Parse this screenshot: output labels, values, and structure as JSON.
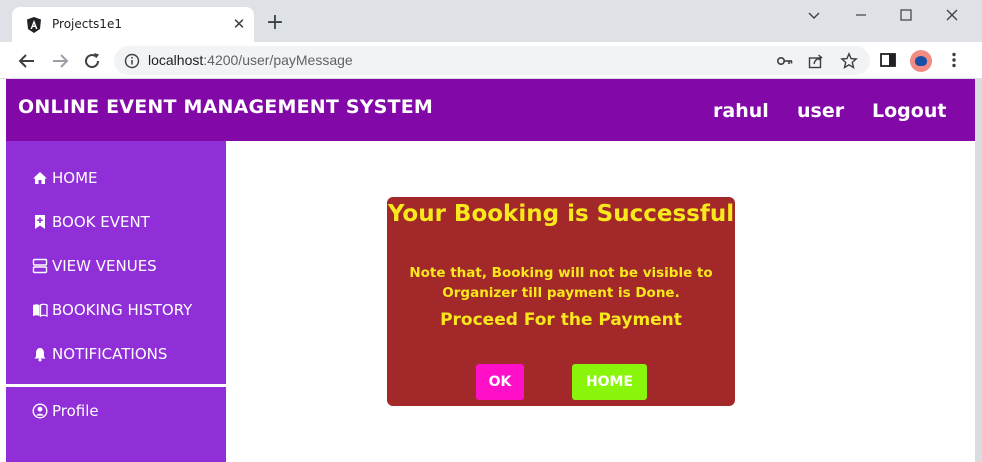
{
  "browser": {
    "tab_title": "Projects1e1",
    "url_host": "localhost",
    "url_path": ":4200/user/payMessage"
  },
  "header": {
    "title": "ONLINE EVENT MANAGEMENT SYSTEM",
    "username": "rahul",
    "role": "user",
    "logout": "Logout",
    "color": "#8208a8"
  },
  "sidebar": {
    "color": "#902fd8",
    "items": [
      {
        "label": "HOME",
        "icon": "home-icon"
      },
      {
        "label": "BOOK EVENT",
        "icon": "bookmark-plus-icon"
      },
      {
        "label": "VIEW VENUES",
        "icon": "list-icon"
      },
      {
        "label": "BOOKING HISTORY",
        "icon": "book-icon"
      },
      {
        "label": "NOTIFICATIONS",
        "icon": "bell-icon"
      },
      {
        "label": "Profile",
        "icon": "user-circle-icon"
      }
    ]
  },
  "modal": {
    "title": "Your Booking is Successful",
    "note_line1": "Note that, Booking will not be visible to",
    "note_line2": "Organizer till payment is Done.",
    "proceed": "Proceed For the Payment",
    "ok_label": "OK",
    "home_label": "HOME",
    "background": "#a2282a",
    "text_color": "#f8e81c",
    "ok_color": "#ff10c8",
    "home_color": "#89f50b"
  }
}
